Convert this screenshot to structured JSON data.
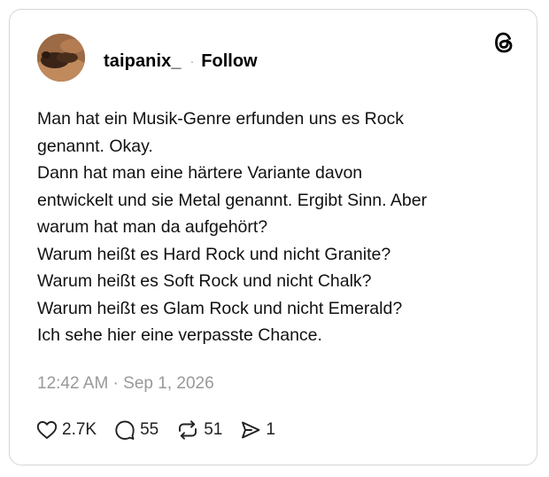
{
  "post": {
    "username": "taipanix_",
    "follow_label": "Follow",
    "separator": "·",
    "body": "Man hat ein Musik-Genre erfunden uns es Rock\ngenannt. Okay.\nDann hat man eine härtere Variante davon\nentwickelt und sie Metal genannt. Ergibt Sinn. Aber\nwarum hat man da aufgehört?\nWarum heißt es Hard Rock und nicht Granite?\nWarum heißt es Soft Rock und nicht Chalk?\nWarum heißt es Glam Rock und nicht Emerald?\nIch sehe hier eine verpasste Chance.",
    "timestamp": "12:42 AM · Sep 1, 2026"
  },
  "actions": {
    "likes": "2.7K",
    "replies": "55",
    "reposts": "51",
    "shares": "1"
  },
  "icons": {
    "brand": "threads-logo-icon",
    "like": "heart-icon",
    "reply": "speech-bubble-icon",
    "repost": "repost-arrows-icon",
    "share": "send-icon"
  },
  "colors": {
    "text": "#000000",
    "muted": "#999999",
    "border": "#d6d6d6"
  }
}
